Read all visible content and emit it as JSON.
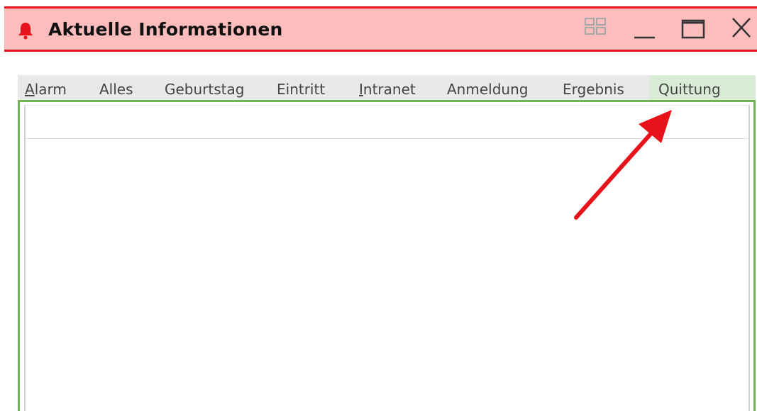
{
  "window": {
    "title": "Aktuelle Informationen",
    "icon": "bell-icon",
    "accent_color": "#e8131a",
    "titlebar_color": "#fdbdbd",
    "controls": [
      "layout-grid-icon",
      "minimize-icon",
      "maximize-icon",
      "close-icon"
    ]
  },
  "tabs": [
    {
      "label": "Alarm",
      "access_key": "A",
      "rest": "larm",
      "active": false
    },
    {
      "label": "Alles",
      "active": false
    },
    {
      "label": "Geburtstag",
      "active": false
    },
    {
      "label": "Eintritt",
      "active": false
    },
    {
      "label": "Intranet",
      "access_key": "I",
      "rest": "ntranet",
      "active": false
    },
    {
      "label": "Anmeldung",
      "active": false
    },
    {
      "label": "Ergebnis",
      "active": false
    },
    {
      "label": "Quittung",
      "active": true
    }
  ],
  "panel": {
    "border_color": "#72b454"
  },
  "annotation": {
    "type": "red-arrow",
    "points_to": "Quittung",
    "color": "#e8131a"
  }
}
